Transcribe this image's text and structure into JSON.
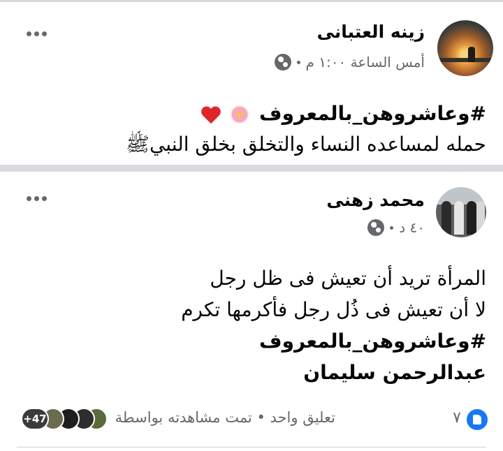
{
  "post1": {
    "author": "زينه العتبانى",
    "time": "أمس الساعة ١:٠٠ م",
    "hashtag": "#وعاشروهن_بالمعروف",
    "text": "حمله لمساعده النساء والتخلق بخلق النبيﷺ"
  },
  "post2": {
    "author": "محمد زهنى",
    "time": "٤٠ د",
    "lines": [
      "المرأة تريد أن تعيش فى ظل رجل",
      "لا أن تعيش فى ذُل رجل فأكرمها تكرم"
    ],
    "hashtag": "#وعاشروهن_بالمعروف",
    "signature": "عبدالرحمن سليمان"
  },
  "footer": {
    "likes": "٧",
    "stats": "تعليق واحد • تمت مشاهدته بواسطة",
    "viewers_more": "+47"
  },
  "colors": {
    "like_blue": "#1877f2",
    "heart_red": "#e0242c",
    "secondary_text": "#65676b",
    "divider": "#d9dbdf"
  },
  "icons": [
    "globe-icon",
    "more-options-icon",
    "heart-emoji-icon",
    "flower-emoji-icon",
    "like-icon"
  ]
}
